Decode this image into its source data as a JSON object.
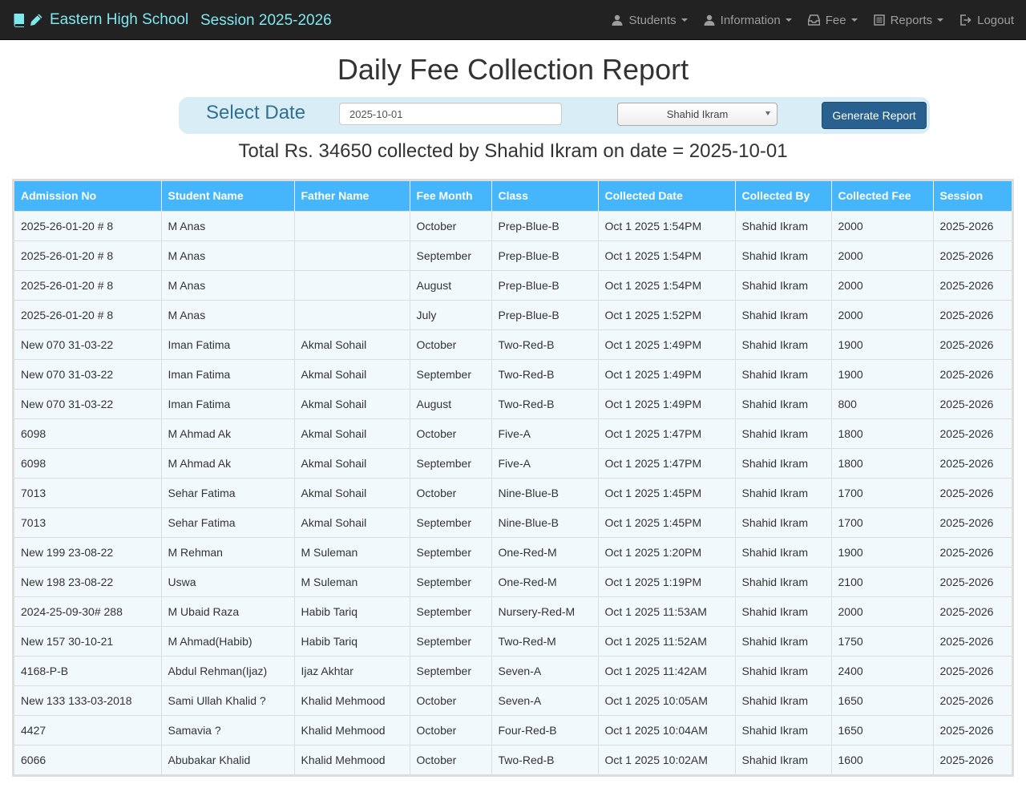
{
  "navbar": {
    "brand": "Eastern High School",
    "session": "Session 2025-2026",
    "menu": [
      {
        "label": "Students",
        "icon": "user-icon",
        "has_dropdown": true
      },
      {
        "label": "Information",
        "icon": "user-icon",
        "has_dropdown": true
      },
      {
        "label": "Fee",
        "icon": "inbox-icon",
        "has_dropdown": true
      },
      {
        "label": "Reports",
        "icon": "list-icon",
        "has_dropdown": true
      },
      {
        "label": "Logout",
        "icon": "logout-icon",
        "has_dropdown": false
      }
    ]
  },
  "page": {
    "title": "Daily Fee Collection Report"
  },
  "filter": {
    "label": "Select Date",
    "date_value": "2025-10-01",
    "collector_selected": "Shahid Ikram",
    "generate_label": "Generate Report"
  },
  "summary": "Total Rs. 34650 collected by Shahid Ikram on date = 2025-10-01",
  "table": {
    "headers": [
      "Admission No",
      "Student Name",
      "Father Name",
      "Fee Month",
      "Class",
      "Collected Date",
      "Collected By",
      "Collected Fee",
      "Session"
    ],
    "rows": [
      [
        "2025-26-01-20 # 8",
        "M Anas",
        "",
        "October",
        "Prep-Blue-B",
        "Oct 1 2025 1:54PM",
        "Shahid Ikram",
        "2000",
        "2025-2026"
      ],
      [
        "2025-26-01-20 # 8",
        "M Anas",
        "",
        "September",
        "Prep-Blue-B",
        "Oct 1 2025 1:54PM",
        "Shahid Ikram",
        "2000",
        "2025-2026"
      ],
      [
        "2025-26-01-20 # 8",
        "M Anas",
        "",
        "August",
        "Prep-Blue-B",
        "Oct 1 2025 1:54PM",
        "Shahid Ikram",
        "2000",
        "2025-2026"
      ],
      [
        "2025-26-01-20 # 8",
        "M Anas",
        "",
        "July",
        "Prep-Blue-B",
        "Oct 1 2025 1:52PM",
        "Shahid Ikram",
        "2000",
        "2025-2026"
      ],
      [
        "New 070 31-03-22",
        "Iman Fatima",
        "Akmal Sohail",
        "October",
        "Two-Red-B",
        "Oct 1 2025 1:49PM",
        "Shahid Ikram",
        "1900",
        "2025-2026"
      ],
      [
        "New 070 31-03-22",
        "Iman Fatima",
        "Akmal Sohail",
        "September",
        "Two-Red-B",
        "Oct 1 2025 1:49PM",
        "Shahid Ikram",
        "1900",
        "2025-2026"
      ],
      [
        "New 070 31-03-22",
        "Iman Fatima",
        "Akmal Sohail",
        "August",
        "Two-Red-B",
        "Oct 1 2025 1:49PM",
        "Shahid Ikram",
        "800",
        "2025-2026"
      ],
      [
        "6098",
        "M Ahmad Ak",
        "Akmal Sohail",
        "October",
        "Five-A",
        "Oct 1 2025 1:47PM",
        "Shahid Ikram",
        "1800",
        "2025-2026"
      ],
      [
        "6098",
        "M Ahmad Ak",
        "Akmal Sohail",
        "September",
        "Five-A",
        "Oct 1 2025 1:47PM",
        "Shahid Ikram",
        "1800",
        "2025-2026"
      ],
      [
        "7013",
        "Sehar Fatima",
        "Akmal Sohail",
        "October",
        "Nine-Blue-B",
        "Oct 1 2025 1:45PM",
        "Shahid Ikram",
        "1700",
        "2025-2026"
      ],
      [
        "7013",
        "Sehar Fatima",
        "Akmal Sohail",
        "September",
        "Nine-Blue-B",
        "Oct 1 2025 1:45PM",
        "Shahid Ikram",
        "1700",
        "2025-2026"
      ],
      [
        "New 199 23-08-22",
        "M Rehman",
        "M Suleman",
        "September",
        "One-Red-M",
        "Oct 1 2025 1:20PM",
        "Shahid Ikram",
        "1900",
        "2025-2026"
      ],
      [
        "New 198 23-08-22",
        "Uswa",
        "M Suleman",
        "September",
        "One-Red-M",
        "Oct 1 2025 1:19PM",
        "Shahid Ikram",
        "2100",
        "2025-2026"
      ],
      [
        "2024-25-09-30# 288",
        "M Ubaid Raza",
        "Habib Tariq",
        "September",
        "Nursery-Red-M",
        "Oct 1 2025 11:53AM",
        "Shahid Ikram",
        "2000",
        "2025-2026"
      ],
      [
        "New 157 30-10-21",
        "M Ahmad(Habib)",
        "Habib Tariq",
        "September",
        "Two-Red-M",
        "Oct 1 2025 11:52AM",
        "Shahid Ikram",
        "1750",
        "2025-2026"
      ],
      [
        "4168-P-B",
        "Abdul Rehman(Ijaz)",
        "Ijaz Akhtar",
        "September",
        "Seven-A",
        "Oct 1 2025 11:42AM",
        "Shahid Ikram",
        "2400",
        "2025-2026"
      ],
      [
        "New 133 133-03-2018",
        "Sami Ullah Khalid ?",
        "Khalid Mehmood",
        "October",
        "Seven-A",
        "Oct 1 2025 10:05AM",
        "Shahid Ikram",
        "1650",
        "2025-2026"
      ],
      [
        "4427",
        "Samavia ?",
        "Khalid Mehmood",
        "October",
        "Four-Red-B",
        "Oct 1 2025 10:04AM",
        "Shahid Ikram",
        "1650",
        "2025-2026"
      ],
      [
        "6066",
        "Abubakar Khalid",
        "Khalid Mehmood",
        "October",
        "Two-Red-B",
        "Oct 1 2025 10:02AM",
        "Shahid Ikram",
        "1600",
        "2025-2026"
      ]
    ]
  }
}
